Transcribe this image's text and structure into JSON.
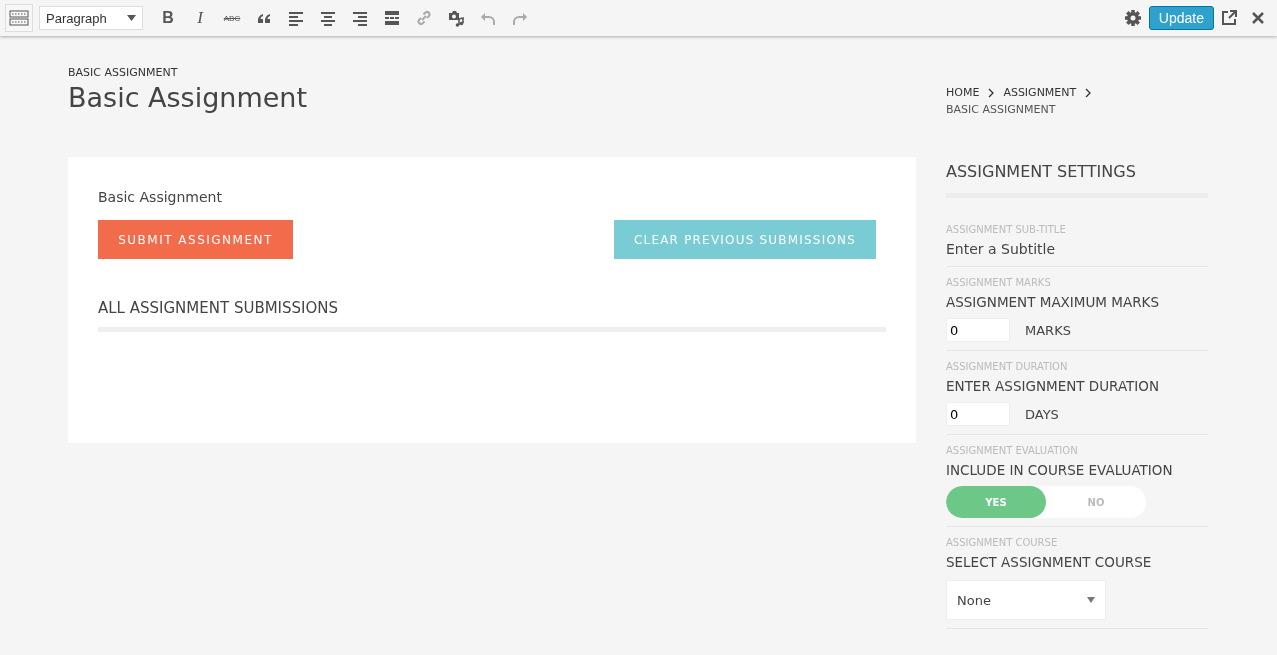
{
  "toolbar": {
    "format": "Paragraph",
    "tools": [
      {
        "kind": "bold",
        "label": "B",
        "disabled": false
      },
      {
        "kind": "italic",
        "label": "I",
        "disabled": false
      },
      {
        "kind": "strike",
        "label": "ABC",
        "disabled": false
      },
      {
        "kind": "quote",
        "disabled": false
      },
      {
        "kind": "align-left",
        "disabled": false
      },
      {
        "kind": "align-center",
        "disabled": false
      },
      {
        "kind": "align-right",
        "disabled": false
      },
      {
        "kind": "more",
        "disabled": false
      },
      {
        "kind": "link",
        "disabled": true
      },
      {
        "kind": "media",
        "disabled": false
      },
      {
        "kind": "undo",
        "disabled": true
      },
      {
        "kind": "redo",
        "disabled": true
      }
    ],
    "update": "Update"
  },
  "header": {
    "eyebrow": "BASIC ASSIGNMENT",
    "title": "Basic Assignment"
  },
  "breadcrumb": [
    "HOME",
    "ASSIGNMENT",
    "BASIC ASSIGNMENT"
  ],
  "card": {
    "text": "Basic Assignment",
    "submit": "SUBMIT ASSIGNMENT",
    "clear": "CLEAR PREVIOUS SUBMISSIONS",
    "section": "ALL ASSIGNMENT SUBMISSIONS"
  },
  "settings": {
    "title": "ASSIGNMENT SETTINGS",
    "fields": [
      {
        "kind": "text",
        "caption": "ASSIGNMENT SUB-TITLE",
        "placeholder": "Enter a Subtitle"
      },
      {
        "kind": "number",
        "caption": "ASSIGNMENT MARKS",
        "label": "ASSIGNMENT MAXIMUM MARKS",
        "value": "0",
        "unit": "MARKS"
      },
      {
        "kind": "number",
        "caption": "ASSIGNMENT DURATION",
        "label": "ENTER ASSIGNMENT DURATION",
        "value": "0",
        "unit": "DAYS"
      },
      {
        "kind": "toggle",
        "caption": "ASSIGNMENT EVALUATION",
        "label": "INCLUDE IN COURSE EVALUATION",
        "options": [
          {
            "label": "YES",
            "selected": true
          },
          {
            "label": "NO",
            "selected": false
          }
        ]
      },
      {
        "kind": "select",
        "caption": "ASSIGNMENT COURSE",
        "label": "SELECT ASSIGNMENT COURSE",
        "value": "None"
      }
    ]
  }
}
